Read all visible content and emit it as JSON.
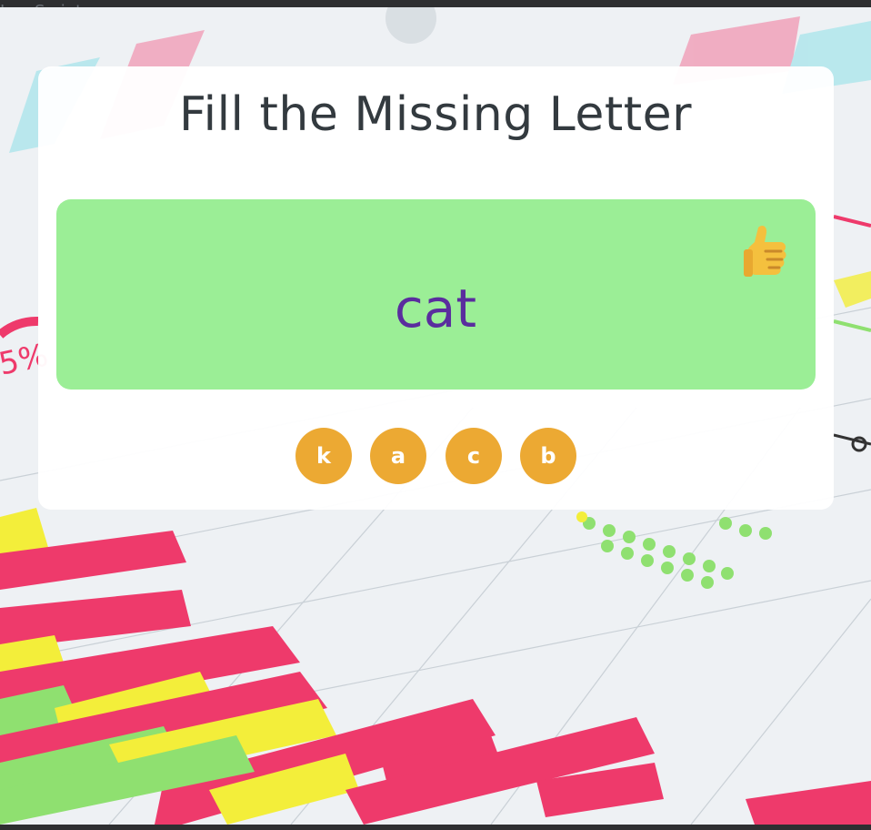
{
  "window": {
    "tab_text": "JavaScript"
  },
  "game": {
    "title": "Fill the Missing Letter",
    "word": "cat",
    "feedback_icon": "thumbs-up",
    "choices": [
      "k",
      "a",
      "c",
      "b"
    ]
  },
  "colors": {
    "panel_correct": "#9bee96",
    "word": "#5a2d9e",
    "choice_button": "#eca933",
    "title": "#333a3f"
  }
}
